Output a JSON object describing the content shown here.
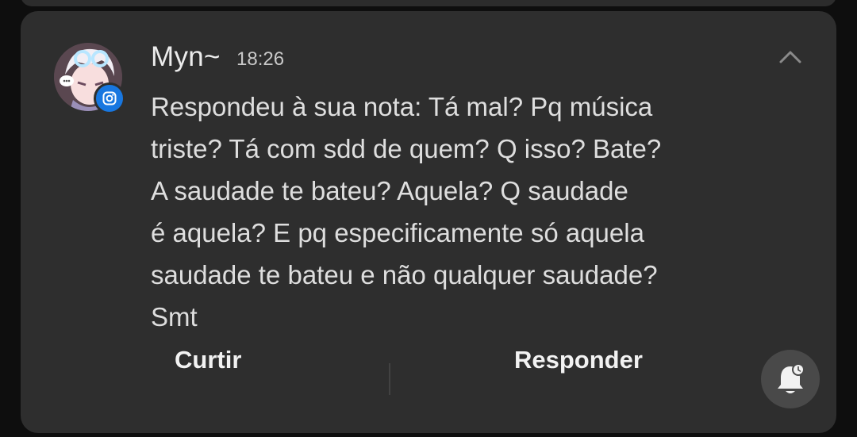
{
  "notification": {
    "sender": "Myn~",
    "time": "18:26",
    "message": "Respondeu à sua nota: Tá mal? Pq música\ntriste? Tá com sdd de quem? Q isso? Bate?\nA saudade te bateu? Aquela? Q saudade\né aquela? E pq especificamente só aquela\nsaudade te bateu e não qualquer saudade?\nSmt",
    "app_icon": "instagram-icon",
    "actions": {
      "like_label": "Curtir",
      "reply_label": "Responder"
    }
  },
  "colors": {
    "background": "#0e0e0e",
    "card": "#2e2e2e",
    "text": "#dedede",
    "badge": "#1877e0",
    "bell_button": "#494949"
  }
}
